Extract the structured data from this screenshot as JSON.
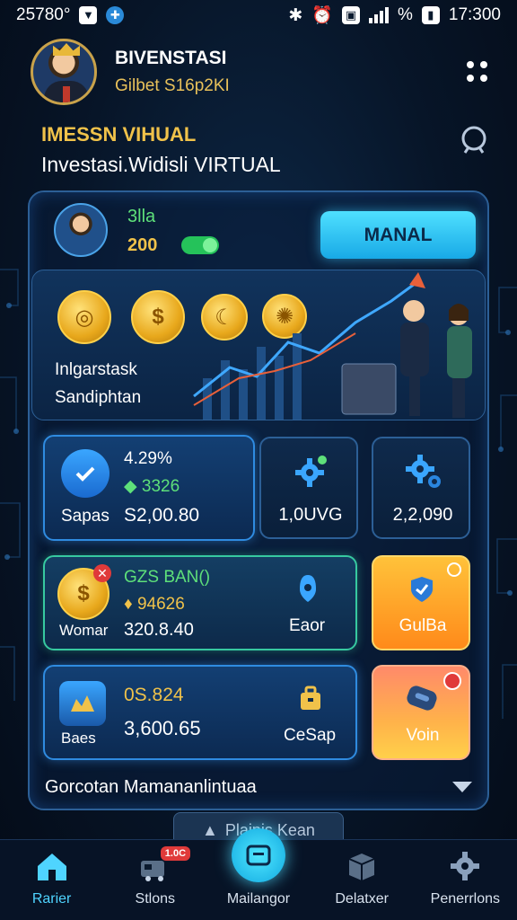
{
  "status_bar": {
    "left_text": "25780°",
    "right_percent": "%",
    "time": "17:300"
  },
  "header": {
    "brand": "BIVENSTASI",
    "sub_brand": "Gilbet S16p2KI"
  },
  "titles": {
    "title_1": "IMESSN VIHUAL",
    "title_2": "Investasi.Widisli VIRTUAL"
  },
  "user": {
    "name": "3lla",
    "balance": "200",
    "button_label": "MANAL"
  },
  "banner": {
    "label_1": "Inlgarstask",
    "label_2": "Sandiphtan"
  },
  "cards": {
    "row1": {
      "label": "Sapas",
      "percent": "4.29%",
      "change": "3326",
      "amount": "S2,00.80",
      "value_2": "1,0UVG",
      "value_3": "2,2,090"
    },
    "row2": {
      "name": "GZS BAN()",
      "change": "94626",
      "label": "Womar",
      "amount": "320.8.40",
      "mid_label": "Eaor",
      "action_label": "GulBa"
    },
    "row3": {
      "value_top": "0S.824",
      "label": "Baes",
      "amount": "3,600.65",
      "mid_label": "CeSap",
      "action_label": "Voin"
    }
  },
  "dropdown": {
    "label": "Gorcotan Mamananlintuaa"
  },
  "floating_pill": {
    "label": "Plaipis Kean"
  },
  "nav": {
    "items": [
      {
        "label": "Rarier",
        "icon": "home-icon"
      },
      {
        "label": "Stlons",
        "icon": "transport-icon",
        "badge": "1.0C"
      },
      {
        "label": "Mailangor",
        "icon": "wallet-icon"
      },
      {
        "label": "Delatxer",
        "icon": "box-icon"
      },
      {
        "label": "Penerrlons",
        "icon": "gear-icon"
      }
    ]
  },
  "colors": {
    "accent": "#4fe0ff",
    "gold": "#f0c24a",
    "green": "#5ee07a",
    "panel_border": "#2c5f96"
  }
}
